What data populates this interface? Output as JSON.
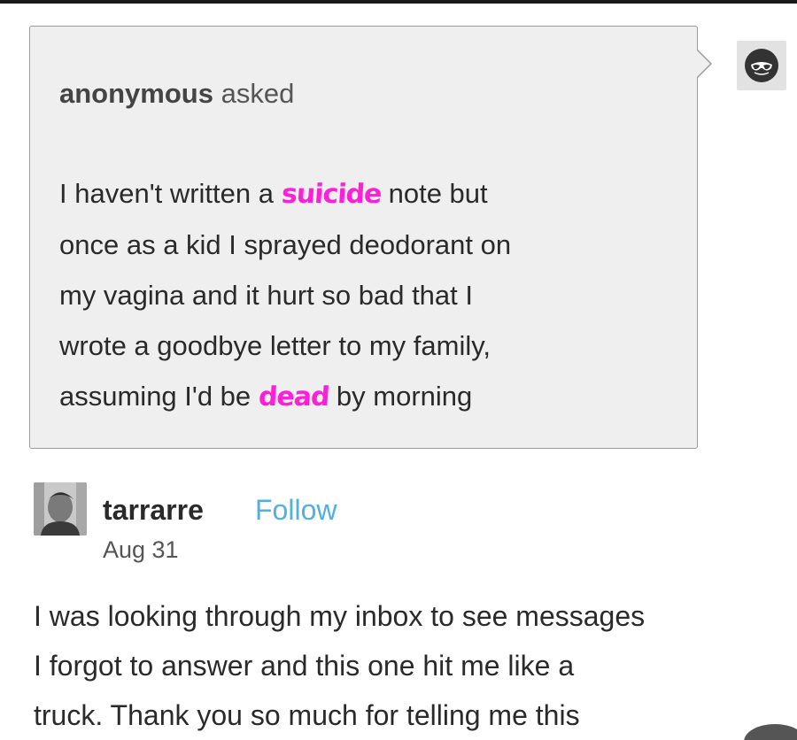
{
  "ask": {
    "asker_name": "anonymous",
    "asker_verb": "asked",
    "lines": [
      {
        "before": "I haven't written a ",
        "highlight": "suicide",
        "after": " note but"
      },
      {
        "before": "once as a kid I sprayed deodorant on",
        "highlight": "",
        "after": ""
      },
      {
        "before": "my vagina and it hurt so bad that I",
        "highlight": "",
        "after": ""
      },
      {
        "before": "wrote a goodbye letter to my family,",
        "highlight": "",
        "after": ""
      },
      {
        "before": "assuming I'd be ",
        "highlight": "dead",
        "after": " by morning"
      }
    ],
    "highlight_color": "#ff1fd6",
    "avatar_icon": "anon-sunglasses-icon"
  },
  "post": {
    "username": "tarrarre",
    "follow_label": "Follow",
    "date": "Aug 31",
    "follow_color": "#4fb0e3",
    "body_lines": [
      "I was looking through my inbox to see messages",
      "I forgot to answer and this one hit me like a",
      "truck. Thank you so much for telling me this"
    ]
  }
}
